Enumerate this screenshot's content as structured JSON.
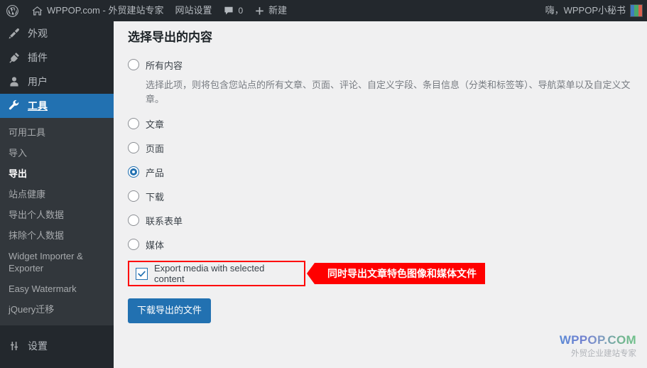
{
  "adminbar": {
    "logo_icon": "wordpress-logo-icon",
    "home_icon": "home-icon",
    "site_name": "WPPOP.com - 外贸建站专家",
    "site_settings": "网站设置",
    "comments_icon": "comment-bubble-icon",
    "comments_count": "0",
    "new_icon": "plus-icon",
    "new_label": "新建",
    "greeting": "嗨，WPPOP小秘书",
    "avatar": "user-avatar"
  },
  "sidebar": {
    "items": [
      {
        "label": "外观",
        "icon": "appearance-brush-icon",
        "current": false
      },
      {
        "label": "插件",
        "icon": "plugins-plug-icon",
        "current": false
      },
      {
        "label": "用户",
        "icon": "users-person-icon",
        "current": false
      },
      {
        "label": "工具",
        "icon": "tools-wrench-icon",
        "current": true
      },
      {
        "label": "设置",
        "icon": "settings-sliders-icon",
        "current": false
      }
    ],
    "submenu": [
      {
        "label": "可用工具",
        "current": false
      },
      {
        "label": "导入",
        "current": false
      },
      {
        "label": "导出",
        "current": true
      },
      {
        "label": "站点健康",
        "current": false
      },
      {
        "label": "导出个人数据",
        "current": false
      },
      {
        "label": "抹除个人数据",
        "current": false
      },
      {
        "label": "Widget Importer & Exporter",
        "current": false
      },
      {
        "label": "Easy Watermark",
        "current": false
      },
      {
        "label": "jQuery迁移",
        "current": false
      }
    ]
  },
  "main": {
    "title": "选择导出的内容",
    "options": [
      {
        "label": "所有内容",
        "checked": false
      },
      {
        "label": "文章",
        "checked": false
      },
      {
        "label": "页面",
        "checked": false
      },
      {
        "label": "产品",
        "checked": true
      },
      {
        "label": "下载",
        "checked": false
      },
      {
        "label": "联系表单",
        "checked": false
      },
      {
        "label": "媒体",
        "checked": false
      }
    ],
    "all_content_description": "选择此项，则将包含您站点的所有文章、页面、评论、自定义字段、条目信息（分类和标签等）、导航菜单以及自定义文章。",
    "media_checkbox": {
      "label": "Export media with selected content",
      "checked": true,
      "highlight_color": "#ff0000"
    },
    "callout": {
      "text": "同时导出文章特色图像和媒体文件",
      "color": "#ff0000"
    },
    "submit_label": "下载导出的文件"
  },
  "watermark": {
    "brand": "WPPOP.COM",
    "tagline": "外贸企业建站专家"
  },
  "colors": {
    "accent": "#2271b1",
    "sidebar_bg": "#23282d",
    "submenu_bg": "#32373c",
    "content_bg": "#f0f0f1",
    "alert": "#ff0000"
  }
}
